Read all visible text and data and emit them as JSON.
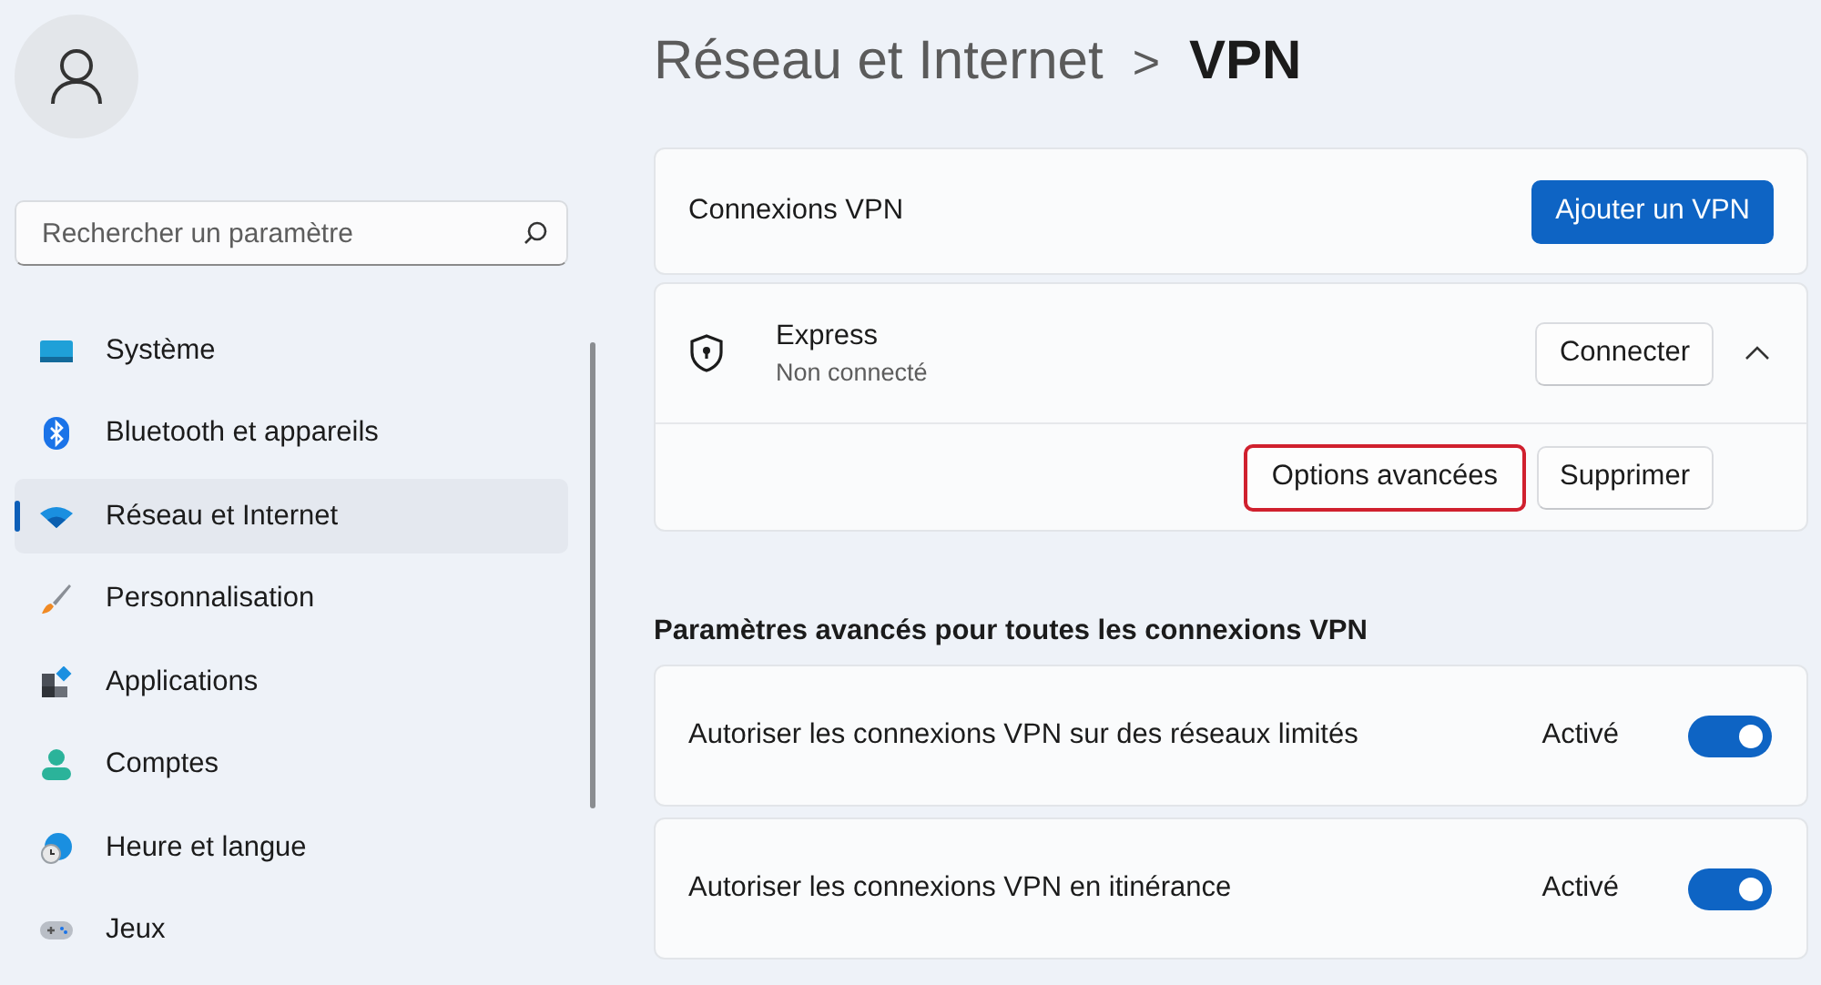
{
  "search": {
    "placeholder": "Rechercher un paramètre"
  },
  "sidebar": {
    "items": [
      {
        "label": "Système",
        "selected": false
      },
      {
        "label": "Bluetooth et appareils",
        "selected": false
      },
      {
        "label": "Réseau et Internet",
        "selected": true
      },
      {
        "label": "Personnalisation",
        "selected": false
      },
      {
        "label": "Applications",
        "selected": false
      },
      {
        "label": "Comptes",
        "selected": false
      },
      {
        "label": "Heure et langue",
        "selected": false
      },
      {
        "label": "Jeux",
        "selected": false
      }
    ]
  },
  "breadcrumb": {
    "parent": "Réseau et Internet",
    "separator": ">",
    "current": "VPN"
  },
  "vpn_connections": {
    "label": "Connexions VPN",
    "button": "Ajouter un VPN"
  },
  "vpn": {
    "name": "Express",
    "status": "Non connecté",
    "connect_button": "Connecter",
    "expanded": true,
    "buttons": [
      {
        "label": "Options avancées",
        "highlighted": true
      },
      {
        "label": "Supprimer",
        "highlighted": false
      }
    ]
  },
  "advanced": {
    "heading": "Paramètres avancés pour toutes les connexions VPN",
    "settings": [
      {
        "label": "Autoriser les connexions VPN sur des réseaux limités",
        "state": "Activé",
        "on": true
      },
      {
        "label": "Autoriser les connexions VPN en itinérance",
        "state": "Activé",
        "on": true
      }
    ]
  }
}
